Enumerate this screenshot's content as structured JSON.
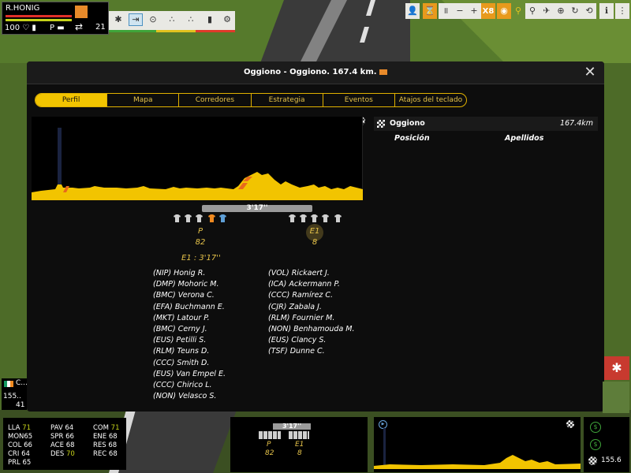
{
  "rider_card": {
    "name": "R.HONIG",
    "energy": "100",
    "position_code": "P",
    "group_count": "21",
    "bar_colors": [
      "#e0302a",
      "#c7d31a",
      "#e2a41f"
    ]
  },
  "action_bar": {
    "icons": [
      "attack-icon",
      "follow-wheel-icon",
      "relay-icon",
      "pace-icon",
      "sprint-icon",
      "bottle-icon",
      "settings-gear-icon"
    ],
    "strip_colors": [
      "#3fa43a",
      "#e2c21f",
      "#e03a2a"
    ]
  },
  "toolbar": {
    "speed": "X8",
    "icons": [
      "rider-portrait-icon",
      "hourglass-icon",
      "pause-icon",
      "minus-icon",
      "plus-icon",
      "eye-icon",
      "cyclist-icon",
      "motorbike-icon",
      "helicopter-icon",
      "target-icon",
      "refresh-icon",
      "reload-icon",
      "info-icon",
      "menu-icon"
    ]
  },
  "modal": {
    "title": "Oggiono - Oggiono. 167.4 km.",
    "close": "✕",
    "tabs": [
      {
        "label": "Perfil",
        "active": true
      },
      {
        "label": "Mapa",
        "active": false
      },
      {
        "label": "Corredores",
        "active": false
      },
      {
        "label": "Estrategia",
        "active": false
      },
      {
        "label": "Eventos",
        "active": false
      },
      {
        "label": "Atajos del teclado",
        "active": false
      }
    ],
    "gap": "3'17''",
    "groups": [
      {
        "code": "P",
        "count": "82"
      },
      {
        "code": "E1",
        "count": "8"
      }
    ],
    "gap_summary": "E1 : 3'17''",
    "peloton_riders": [
      "(NIP) Honig R.",
      "(DMP) Mohoric M.",
      "(BMC) Verona C.",
      "(EFA) Buchmann E.",
      "(MKT) Latour P.",
      "(BMC) Cerny J.",
      "(EUS) Petilli S.",
      "(RLM) Teuns D.",
      "(CCC) Smith D.",
      "(EUS) Van Empel E.",
      "(CCC) Chirico L.",
      "(NON) Velasco S."
    ],
    "escape_riders": [
      "(VOL) Rickaert J.",
      "(ICA) Ackermann P.",
      "(CCC) Ramírez C.",
      "(CJR) Zabala J.",
      "(RLM) Fournier M.",
      "(NON) Benhamouda M.",
      "(EUS) Clancy S.",
      "(TSF) Dunne C."
    ],
    "finish": {
      "name": "Oggiono",
      "distance": "167.4km"
    },
    "columns": {
      "position": "Posición",
      "surname": "Apellidos"
    }
  },
  "mini_card": {
    "line1": "C...",
    "line2": "155..",
    "line3": "41"
  },
  "stats": [
    {
      "k": "LLA",
      "v": "71",
      "hi": true
    },
    {
      "k": "PAV",
      "v": "64",
      "hi": false
    },
    {
      "k": "COM",
      "v": "71",
      "hi": true
    },
    {
      "k": "MON",
      "v": "65",
      "hi": false
    },
    {
      "k": "SPR",
      "v": "66",
      "hi": false
    },
    {
      "k": "ENE",
      "v": "68",
      "hi": false
    },
    {
      "k": "COL",
      "v": "66",
      "hi": false
    },
    {
      "k": "ACE",
      "v": "68",
      "hi": false
    },
    {
      "k": "RES",
      "v": "68",
      "hi": false
    },
    {
      "k": "CRI",
      "v": "64",
      "hi": false
    },
    {
      "k": "DES",
      "v": "70",
      "hi": true
    },
    {
      "k": "REC",
      "v": "68",
      "hi": false
    },
    {
      "k": "PRL",
      "v": "65",
      "hi": false
    }
  ],
  "bottom": {
    "gap": "3'17''",
    "groups": [
      {
        "code": "P",
        "count": "82"
      },
      {
        "code": "E1",
        "count": "8"
      }
    ],
    "remaining": "155.6"
  }
}
